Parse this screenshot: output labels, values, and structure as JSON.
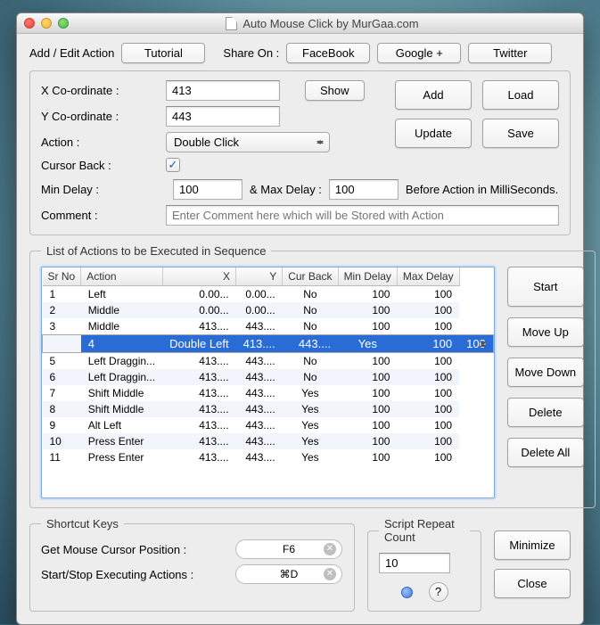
{
  "window": {
    "title": "Auto Mouse Click by MurGaa.com"
  },
  "topbar": {
    "add_edit_label": "Add / Edit Action",
    "tutorial": "Tutorial",
    "share_on": "Share On :",
    "facebook": "FaceBook",
    "google": "Google +",
    "twitter": "Twitter"
  },
  "form": {
    "x_label": "X Co-ordinate :",
    "x_value": "413",
    "y_label": "Y Co-ordinate :",
    "y_value": "443",
    "show": "Show",
    "action_label": "Action :",
    "action_value": "Double Click",
    "cursor_back_label": "Cursor Back :",
    "cursor_back_checked": true,
    "min_delay_label": "Min Delay :",
    "min_delay_value": "100",
    "max_delay_label": "& Max Delay :",
    "max_delay_value": "100",
    "delay_suffix": "Before Action in MilliSeconds.",
    "comment_label": "Comment :",
    "comment_placeholder": "Enter Comment here which will be Stored with Action"
  },
  "sidebuttons": {
    "add": "Add",
    "load": "Load",
    "update": "Update",
    "save": "Save",
    "start": "Start",
    "move_up": "Move Up",
    "move_down": "Move Down",
    "delete": "Delete",
    "delete_all": "Delete All",
    "minimize": "Minimize",
    "close": "Close"
  },
  "list": {
    "legend": "List of Actions to be Executed in Sequence",
    "headers": {
      "sr": "Sr No",
      "action": "Action",
      "x": "X",
      "y": "Y",
      "cur": "Cur Back",
      "min": "Min Delay",
      "max": "Max Delay"
    },
    "rows": [
      {
        "sr": "1",
        "action": "Left",
        "x": "0.00...",
        "y": "0.00...",
        "cur": "No",
        "min": "100",
        "max": "100",
        "selected": false
      },
      {
        "sr": "2",
        "action": "Middle",
        "x": "0.00...",
        "y": "0.00...",
        "cur": "No",
        "min": "100",
        "max": "100",
        "selected": false
      },
      {
        "sr": "3",
        "action": "Middle",
        "x": "413....",
        "y": "443....",
        "cur": "No",
        "min": "100",
        "max": "100",
        "selected": false
      },
      {
        "sr": "4",
        "action": "Double Left",
        "x": "413....",
        "y": "443....",
        "cur": "Yes",
        "min": "100",
        "max": "100",
        "selected": true
      },
      {
        "sr": "5",
        "action": "Left Draggin...",
        "x": "413....",
        "y": "443....",
        "cur": "No",
        "min": "100",
        "max": "100",
        "selected": false
      },
      {
        "sr": "6",
        "action": "Left Draggin...",
        "x": "413....",
        "y": "443....",
        "cur": "No",
        "min": "100",
        "max": "100",
        "selected": false
      },
      {
        "sr": "7",
        "action": "Shift Middle",
        "x": "413....",
        "y": "443....",
        "cur": "Yes",
        "min": "100",
        "max": "100",
        "selected": false
      },
      {
        "sr": "8",
        "action": "Shift Middle",
        "x": "413....",
        "y": "443....",
        "cur": "Yes",
        "min": "100",
        "max": "100",
        "selected": false
      },
      {
        "sr": "9",
        "action": "Alt Left",
        "x": "413....",
        "y": "443....",
        "cur": "Yes",
        "min": "100",
        "max": "100",
        "selected": false
      },
      {
        "sr": "10",
        "action": "Press Enter",
        "x": "413....",
        "y": "443....",
        "cur": "Yes",
        "min": "100",
        "max": "100",
        "selected": false
      },
      {
        "sr": "11",
        "action": "Press Enter",
        "x": "413....",
        "y": "443....",
        "cur": "Yes",
        "min": "100",
        "max": "100",
        "selected": false
      }
    ]
  },
  "shortcut": {
    "legend": "Shortcut Keys",
    "get_pos_label": "Get Mouse Cursor Position :",
    "get_pos_key": "F6",
    "start_stop_label": "Start/Stop Executing Actions :",
    "start_stop_key": "⌘D"
  },
  "repeat": {
    "legend": "Script Repeat Count",
    "value": "10"
  }
}
